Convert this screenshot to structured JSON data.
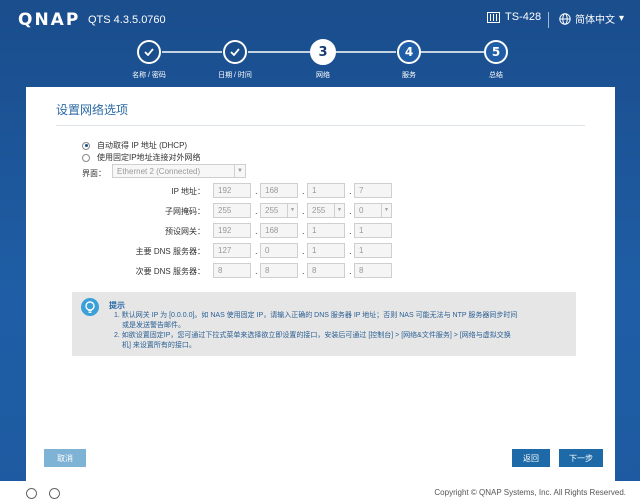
{
  "header": {
    "logo": "QNAP",
    "version": "QTS 4.3.5.0760",
    "model": "TS-428",
    "language": "简体中文",
    "language_caret": "▾"
  },
  "wizard": {
    "steps": [
      {
        "number": "",
        "label": "名称 / 密码",
        "state": "done"
      },
      {
        "number": "",
        "label": "日期 / 时间",
        "state": "done"
      },
      {
        "number": "3",
        "label": "网络",
        "state": "current"
      },
      {
        "number": "4",
        "label": "服务",
        "state": "todo"
      },
      {
        "number": "5",
        "label": "总结",
        "state": "todo"
      }
    ]
  },
  "panel": {
    "title": "设置网络选项",
    "radio_dhcp": "自动取得 IP 地址 (DHCP)",
    "radio_static": "使用固定IP地址连接对外网络",
    "selected_mode": "dhcp",
    "interface_label": "界面：",
    "interface_value": "Ethernet 2 (Connected)",
    "fields": {
      "ip": {
        "label": "IP 地址：",
        "octets": [
          "192",
          "168",
          "1",
          "7"
        ]
      },
      "mask": {
        "label": "子网掩码：",
        "octets": [
          "255",
          "255",
          "255",
          "0"
        ]
      },
      "gateway": {
        "label": "预设网关：",
        "octets": [
          "192",
          "168",
          "1",
          "1"
        ]
      },
      "dns1": {
        "label": "主要 DNS 服务器：",
        "octets": [
          "127",
          "0",
          "1",
          "1"
        ]
      },
      "dns2": {
        "label": "次要 DNS 服务器：",
        "octets": [
          "8",
          "8",
          "8",
          "8"
        ]
      }
    },
    "octet_separator": "."
  },
  "tips": {
    "title": "提示",
    "lines": [
      "1. 默认网关 IP 为 [0.0.0.0]。如 NAS 使用固定 IP，请输入正确的 DNS 服务器 IP 地址；否则 NAS 可能无法与 NTP 服务器同步时间",
      "或是发送警告邮件。",
      "2. 如欲设置固定IP，您可通过下拉式菜单来选择欲立即设置的接口，安装后可通过 [控制台] > [网络&文件服务] > [网络与虚拟交换",
      "机] 来设置所有的接口。"
    ]
  },
  "buttons": {
    "cancel": "取消",
    "back": "返回",
    "next": "下一步"
  },
  "footer": {
    "copyright": "Copyright © QNAP Systems, Inc. All Rights Reserved."
  },
  "colors": {
    "background": "#1f5ea6",
    "accent": "#1e6aa8",
    "title": "#2a6aa8"
  }
}
